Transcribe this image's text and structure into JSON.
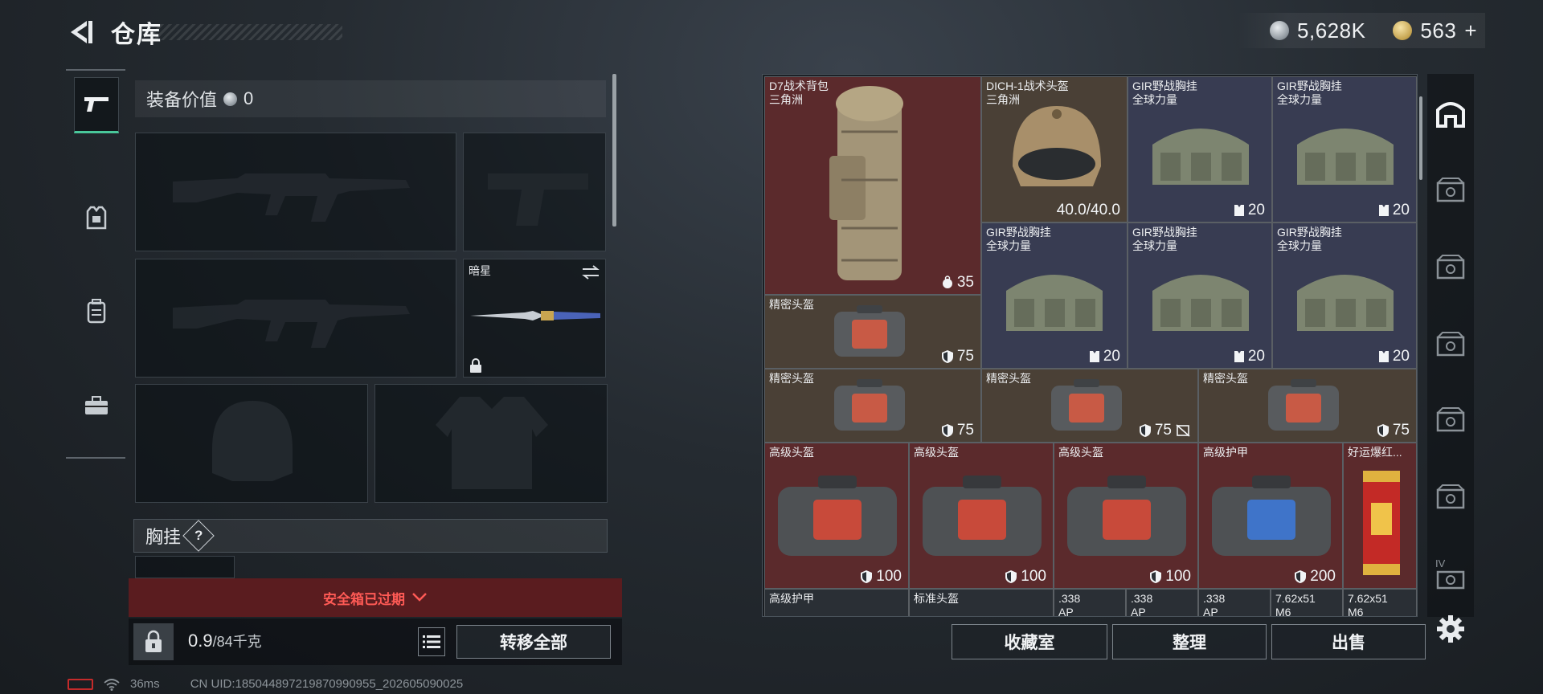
{
  "header": {
    "title": "仓库",
    "currency_silver": "5,628K",
    "currency_gold": "563",
    "add_symbol": "+"
  },
  "equipment": {
    "value_label": "装备价值",
    "value": "0",
    "knife_name": "暗星",
    "chest_label": "胸挂",
    "help_symbol": "?",
    "safebox_expired": "安全箱已过期"
  },
  "footer_left": {
    "weight_current": "0.9",
    "weight_max": "/84千克",
    "transfer_all": "转移全部"
  },
  "status_bar": {
    "ping": "36ms",
    "uid": "CN UID:185044897219870990955_202605090025"
  },
  "storage": {
    "items": [
      {
        "name": "D7战术背包",
        "sub": "三角洲",
        "value": "35",
        "icon": "weight-icon"
      },
      {
        "name": "DICH-1战术头盔",
        "sub": "三角洲",
        "value": "40.0/40.0"
      },
      {
        "name": "GIR野战胸挂",
        "sub": "全球力量",
        "value": "20",
        "icon": "vest-icon"
      },
      {
        "name": "GIR野战胸挂",
        "sub": "全球力量",
        "value": "20",
        "icon": "vest-icon"
      },
      {
        "name": "GIR野战胸挂",
        "sub": "全球力量",
        "value": "20",
        "icon": "vest-icon"
      },
      {
        "name": "GIR野战胸挂",
        "sub": "全球力量",
        "value": "20",
        "icon": "vest-icon"
      },
      {
        "name": "GIR野战胸挂",
        "sub": "全球力量",
        "value": "20",
        "icon": "vest-icon"
      },
      {
        "name": "精密头盔",
        "sub": "",
        "value": "75",
        "icon": "shield-icon"
      },
      {
        "name": "精密头盔",
        "sub": "",
        "value": "75",
        "icon": "shield-icon"
      },
      {
        "name": "精密头盔",
        "sub": "",
        "value": "75",
        "icon": "shield-icon"
      },
      {
        "name": "精密头盔",
        "sub": "",
        "value": "75",
        "icon": "shield-icon"
      },
      {
        "name": "高级头盔",
        "sub": "",
        "value": "100",
        "icon": "shield-icon"
      },
      {
        "name": "高级头盔",
        "sub": "",
        "value": "100",
        "icon": "shield-icon"
      },
      {
        "name": "高级头盔",
        "sub": "",
        "value": "100",
        "icon": "shield-icon"
      },
      {
        "name": "高级护甲",
        "sub": "",
        "value": "200",
        "icon": "shield-icon"
      },
      {
        "name": "好运爆红...",
        "sub": "",
        "value": ""
      },
      {
        "name": "高级护甲",
        "sub": "",
        "value": ""
      },
      {
        "name": "标准头盔",
        "sub": "",
        "value": ""
      },
      {
        "name": ".338",
        "sub": "AP",
        "value": ""
      },
      {
        "name": ".338",
        "sub": "AP",
        "value": ""
      },
      {
        "name": ".338",
        "sub": "AP",
        "value": ""
      },
      {
        "name": "7.62x51",
        "sub": "M6",
        "value": ""
      },
      {
        "name": "7.62x51",
        "sub": "M6",
        "value": ""
      }
    ]
  },
  "actions": {
    "collection": "收藏室",
    "organize": "整理",
    "sell": "出售"
  },
  "side_tabs": {
    "roman_4": "IV"
  }
}
